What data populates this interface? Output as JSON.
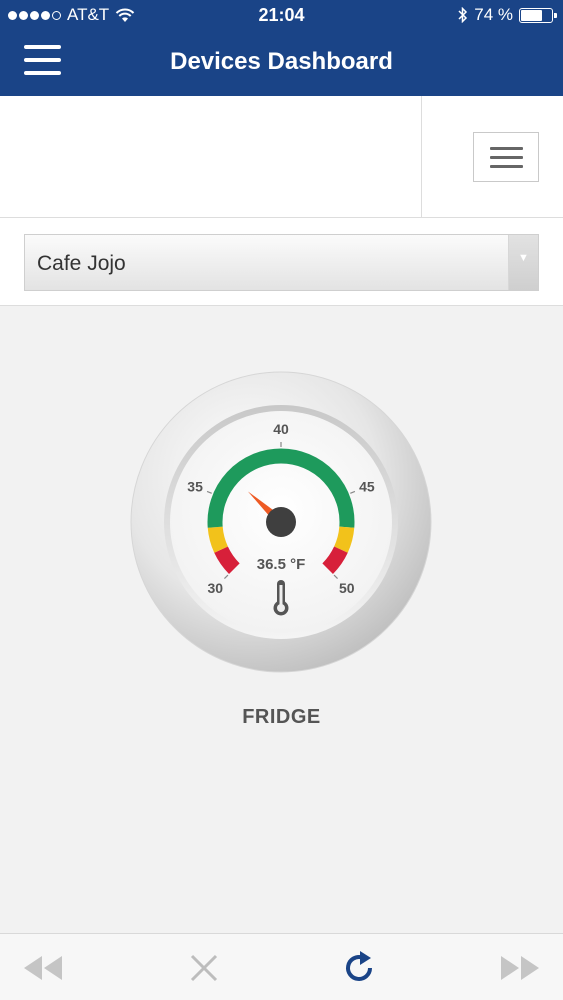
{
  "status_bar": {
    "carrier": "AT&T",
    "time": "21:04",
    "battery_percent": "74 %",
    "battery_level": 0.74,
    "signal_bars_filled": 4,
    "signal_bars_total": 5
  },
  "header": {
    "title": "Devices Dashboard",
    "menu_icon": "hamburger-menu-icon",
    "background_color": "#1a4487"
  },
  "toolbar": {
    "options_icon": "list-menu-icon"
  },
  "location_select": {
    "selected": "Cafe Jojo"
  },
  "gauge": {
    "type": "temperature-dial",
    "min": 30,
    "max": 50,
    "tick_labels": [
      "30",
      "35",
      "40",
      "45",
      "50"
    ],
    "value": 36.5,
    "reading": "36.5 °F",
    "zones": [
      {
        "from": 30,
        "to": 31.5,
        "color": "#d7203a"
      },
      {
        "from": 31.5,
        "to": 33,
        "color": "#f2c21b"
      },
      {
        "from": 33,
        "to": 47,
        "color": "#1e9a5c"
      },
      {
        "from": 47,
        "to": 48.5,
        "color": "#f2c21b"
      },
      {
        "from": 48.5,
        "to": 50,
        "color": "#d7203a"
      }
    ],
    "needle_color": "#ee5a24",
    "icon": "thermometer-icon"
  },
  "device": {
    "name": "FRIDGE"
  },
  "bottom_nav": {
    "rewind_icon": "rewind-icon",
    "close_icon": "close-icon",
    "refresh_icon": "refresh-icon",
    "forward_icon": "fast-forward-icon",
    "accent_color": "#1a4487"
  }
}
